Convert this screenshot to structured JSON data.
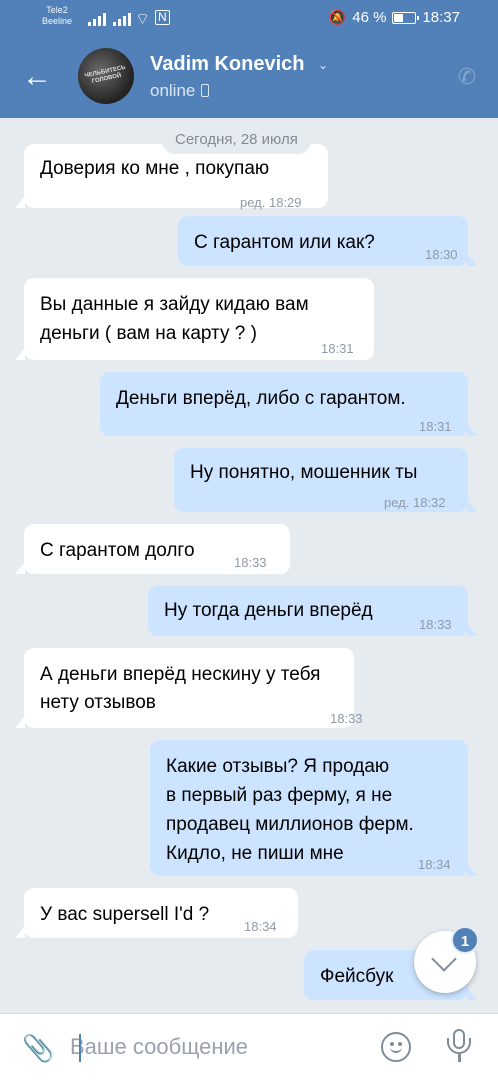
{
  "status_bar": {
    "carrier1": "Tele2",
    "carrier2": "Beeline",
    "battery_text": "46 %",
    "battery_level": 0.46,
    "time": "18:37"
  },
  "header": {
    "contact_name": "Vadim Konevich",
    "status": "online",
    "avatar_text": "ЧЕЛЬБИТЕСЬ ГОЛОВОЙ",
    "accent_color": "#5181b8"
  },
  "chat": {
    "date_label": "Сегодня, 28 июля",
    "messages": [
      {
        "dir": "in",
        "lines": [
          "Доверия ко мне , покупаю"
        ],
        "time": "ред. 18:29"
      },
      {
        "dir": "out",
        "lines": [
          "С гарантом или как?"
        ],
        "time": "18:30"
      },
      {
        "dir": "in",
        "lines": [
          "Вы данные я зайду кидаю вам",
          "деньги ( вам на карту ? )"
        ],
        "time": "18:31"
      },
      {
        "dir": "out",
        "lines": [
          "Деньги вперёд, либо с гарантом."
        ],
        "time": "18:31"
      },
      {
        "dir": "out",
        "lines": [
          "Ну понятно, мошенник ты"
        ],
        "time": "ред. 18:32"
      },
      {
        "dir": "in",
        "lines": [
          "С гарантом долго"
        ],
        "time": "18:33"
      },
      {
        "dir": "out",
        "lines": [
          "Ну тогда деньги вперёд"
        ],
        "time": "18:33"
      },
      {
        "dir": "in",
        "lines": [
          "А деньги вперёд нескину у тебя",
          "нету отзывов"
        ],
        "time": "18:33"
      },
      {
        "dir": "out",
        "lines": [
          "Какие отзывы? Я продаю",
          "в первый раз ферму, я не",
          "продавец миллионов ферм.",
          "Кидло, не пиши мне"
        ],
        "time": "18:34"
      },
      {
        "dir": "in",
        "lines": [
          "У вас supersell I'd ?"
        ],
        "time": "18:34"
      },
      {
        "dir": "out",
        "lines": [
          "Фейсбук"
        ],
        "time": ""
      }
    ],
    "unread_badge": "1"
  },
  "composer": {
    "placeholder": "Ваше сообщение"
  }
}
